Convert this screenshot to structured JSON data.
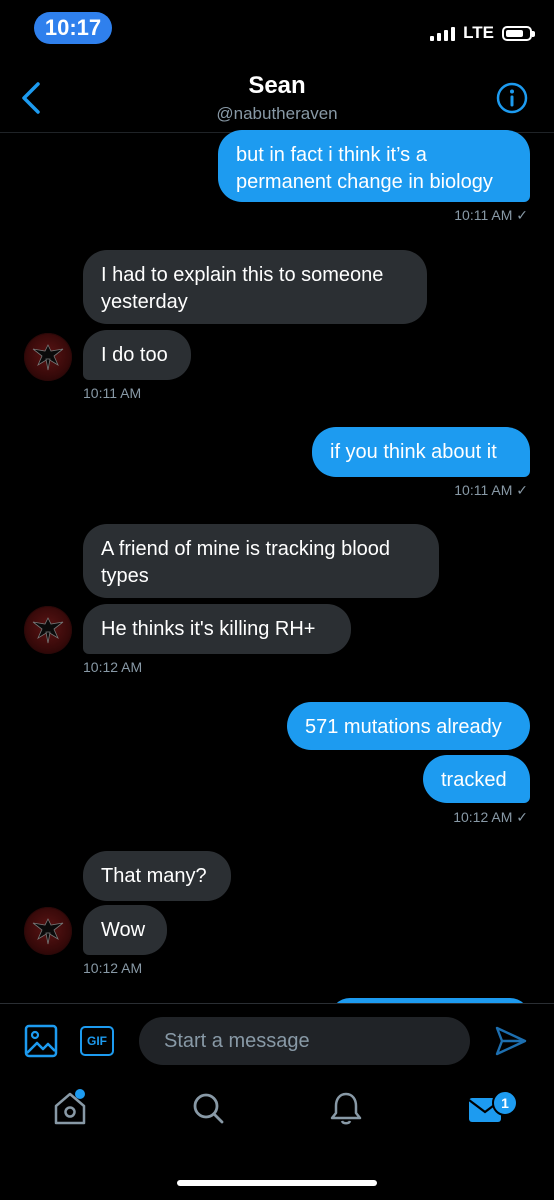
{
  "status_bar": {
    "time": "10:17",
    "network": "LTE"
  },
  "header": {
    "title": "Sean",
    "handle": "@nabutheraven"
  },
  "messages": [
    {
      "direction": "outgoing",
      "text": "but in fact i think it’s a\npermanent change in biology"
    },
    {
      "direction": "incoming",
      "text": "I had to explain this to someone\nyesterday"
    },
    {
      "direction": "incoming",
      "text": "I do too"
    },
    {
      "direction": "outgoing",
      "text": "if you think about it"
    },
    {
      "direction": "incoming",
      "text": "A friend of mine is tracking blood\ntypes"
    },
    {
      "direction": "incoming",
      "text": "He thinks it's killing RH+"
    },
    {
      "direction": "outgoing",
      "text": "571 mutations already"
    },
    {
      "direction": "outgoing",
      "text": "tracked"
    },
    {
      "direction": "incoming",
      "text": "That many?"
    },
    {
      "direction": "incoming",
      "text": "Wow"
    }
  ],
  "timestamps": {
    "t1": "10:11 AM ✓",
    "t2": "10:11 AM",
    "t3": "10:11 AM ✓",
    "t4": "10:12 AM",
    "t5": "10:12 AM ✓",
    "t6": "10:12 AM"
  },
  "composer": {
    "placeholder": "Start a message",
    "gif_label": "GIF"
  },
  "tab_bar": {
    "items": [
      "home-icon",
      "search-icon",
      "notifications-icon",
      "messages-icon"
    ],
    "messages_badge": "1"
  },
  "colors": {
    "accent": "#1d9bf0",
    "incoming_bubble": "#2b2f33",
    "muted_text": "#8899a6"
  }
}
